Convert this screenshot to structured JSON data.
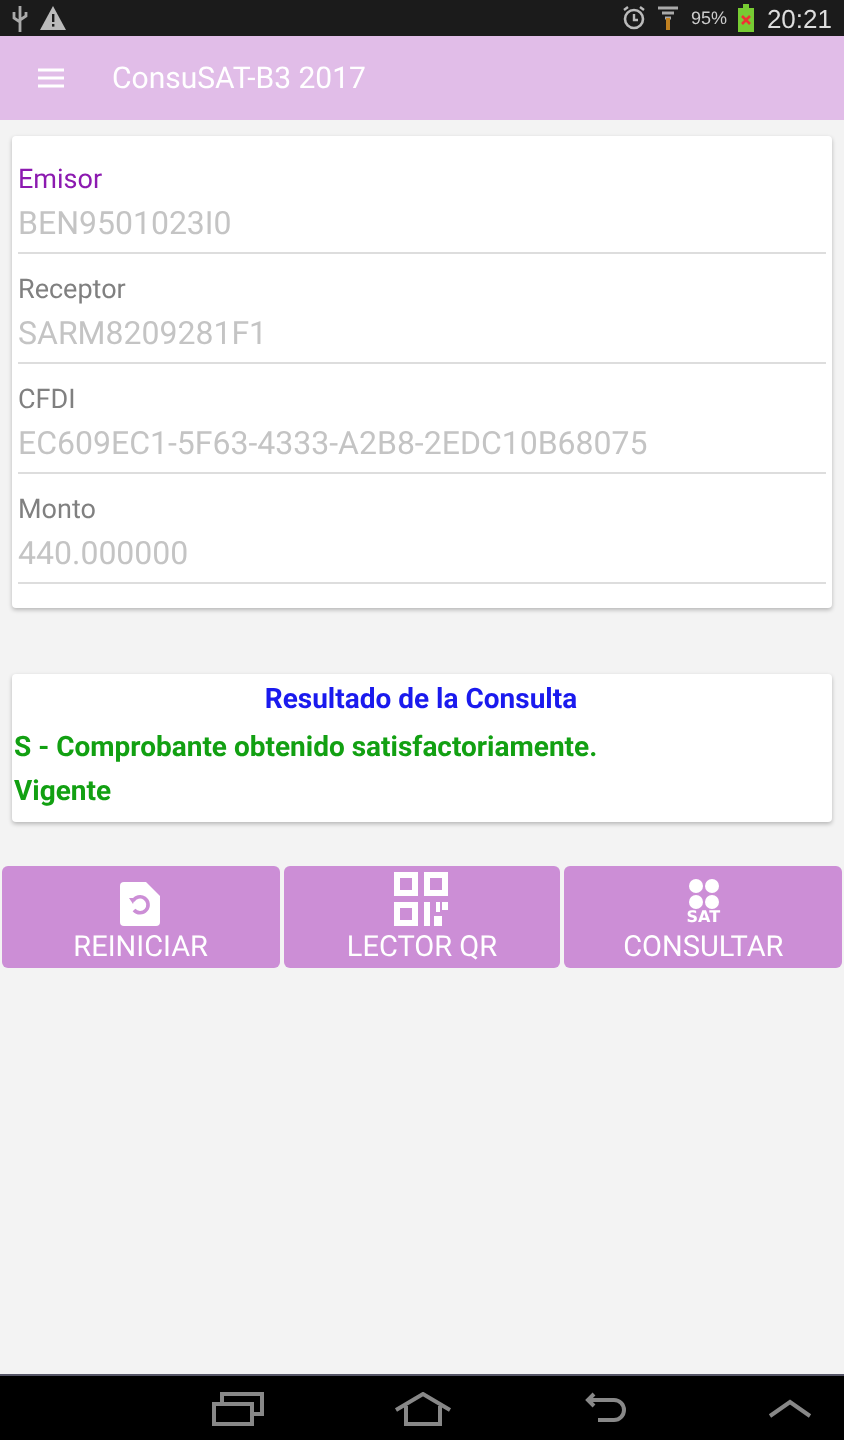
{
  "status_bar": {
    "battery": "95%",
    "time": "20:21"
  },
  "toolbar": {
    "title": "ConsuSAT-B3 2017"
  },
  "fields": [
    {
      "label": "Emisor",
      "value": "BEN9501023I0",
      "focused": true
    },
    {
      "label": "Receptor",
      "value": "SARM8209281F1",
      "focused": false
    },
    {
      "label": "CFDI",
      "value": "EC609EC1-5F63-4333-A2B8-2EDC10B68075",
      "focused": false
    },
    {
      "label": "Monto",
      "value": "440.000000",
      "focused": false
    }
  ],
  "result": {
    "title": "Resultado de la Consulta",
    "message": "S - Comprobante obtenido satisfactoriamente.",
    "status": "Vigente"
  },
  "buttons": [
    {
      "kind": "reset",
      "label": "REINICIAR"
    },
    {
      "kind": "qr",
      "label": "LECTOR QR"
    },
    {
      "kind": "sat",
      "label": "CONSULTAR",
      "icon_text": "SAT"
    }
  ]
}
